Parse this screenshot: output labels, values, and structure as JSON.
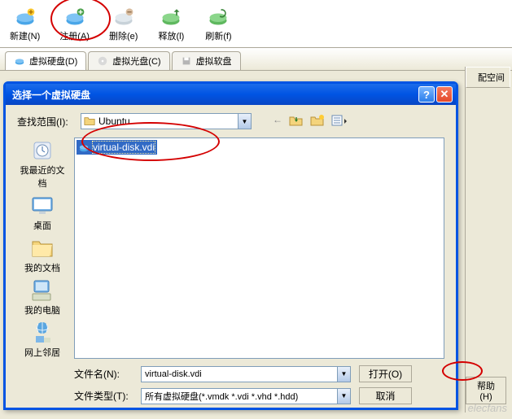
{
  "toolbar": {
    "new_label": "新建(N)",
    "register_label": "注册(A)",
    "delete_label": "删除(e)",
    "release_label": "释放(l)",
    "refresh_label": "刷新(f)"
  },
  "tabs": {
    "hdd": "虚拟硬盘(D)",
    "cd": "虚拟光盘(C)",
    "fd": "虚拟软盘"
  },
  "columns": {
    "space": "配空间"
  },
  "help_button": "帮助(H)",
  "dialog": {
    "title": "选择一个虚拟硬盘",
    "lookin_label": "查找范围(I):",
    "lookin_value": "Ubuntu",
    "filename_label": "文件名(N):",
    "filename_value": "virtual-disk.vdi",
    "filetype_label": "文件类型(T):",
    "filetype_value": "所有虚拟硬盘(*.vmdk *.vdi *.vhd *.hdd)",
    "open_btn": "打开(O)",
    "cancel_btn": "取消",
    "help_symbol": "?",
    "close_symbol": "✕"
  },
  "sidebar": {
    "recent": "我最近的文档",
    "desktop": "桌面",
    "mydocs": "我的文档",
    "mycomputer": "我的电脑",
    "network": "网上邻居"
  },
  "file_list": {
    "selected": "virtual-disk.vdi"
  },
  "watermark": "elecfans"
}
